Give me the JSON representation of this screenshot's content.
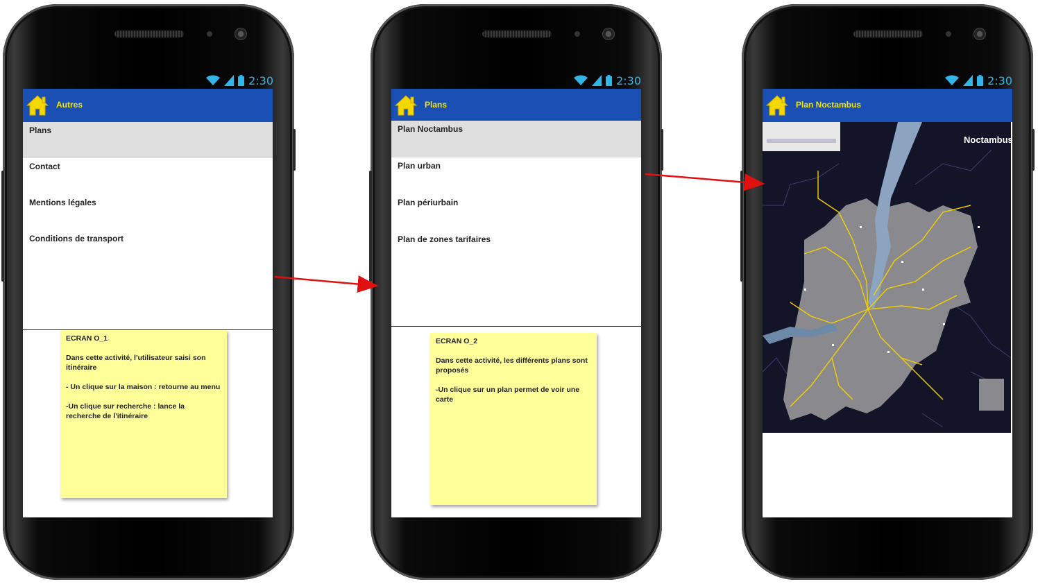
{
  "status_bar": {
    "time": "2:30"
  },
  "screens": [
    {
      "title": "Autres",
      "items": [
        "Plans",
        "Contact",
        "Mentions légales",
        "Conditions de transport"
      ],
      "note": {
        "heading": "ECRAN O_1",
        "lines": [
          "Dans cette activité, l'utilisateur saisi son itinéraire",
          "- Un clique sur la maison : retourne au menu",
          "-Un clique sur recherche : lance la recherche de l'itinéraire"
        ]
      }
    },
    {
      "title": "Plans",
      "items": [
        "Plan Noctambus",
        "Plan urban",
        "Plan périurbain",
        "Plan de zones tarifaires"
      ],
      "note": {
        "heading": "ECRAN O_2",
        "lines": [
          "Dans cette activité, les différents plans sont proposés",
          "-Un clique sur un plan permet de voir une carte"
        ]
      }
    },
    {
      "title": "Plan Noctambus",
      "map": {
        "brand": "Noctambus"
      }
    }
  ],
  "colors": {
    "appbar": "#1a50b4",
    "title": "#f5e400",
    "home_icon": "#f5d800",
    "note": "#ffff99",
    "arrow": "#e01010",
    "status": "#33b5e5"
  },
  "icons": [
    "home-icon",
    "wifi-icon",
    "signal-icon",
    "battery-icon"
  ]
}
